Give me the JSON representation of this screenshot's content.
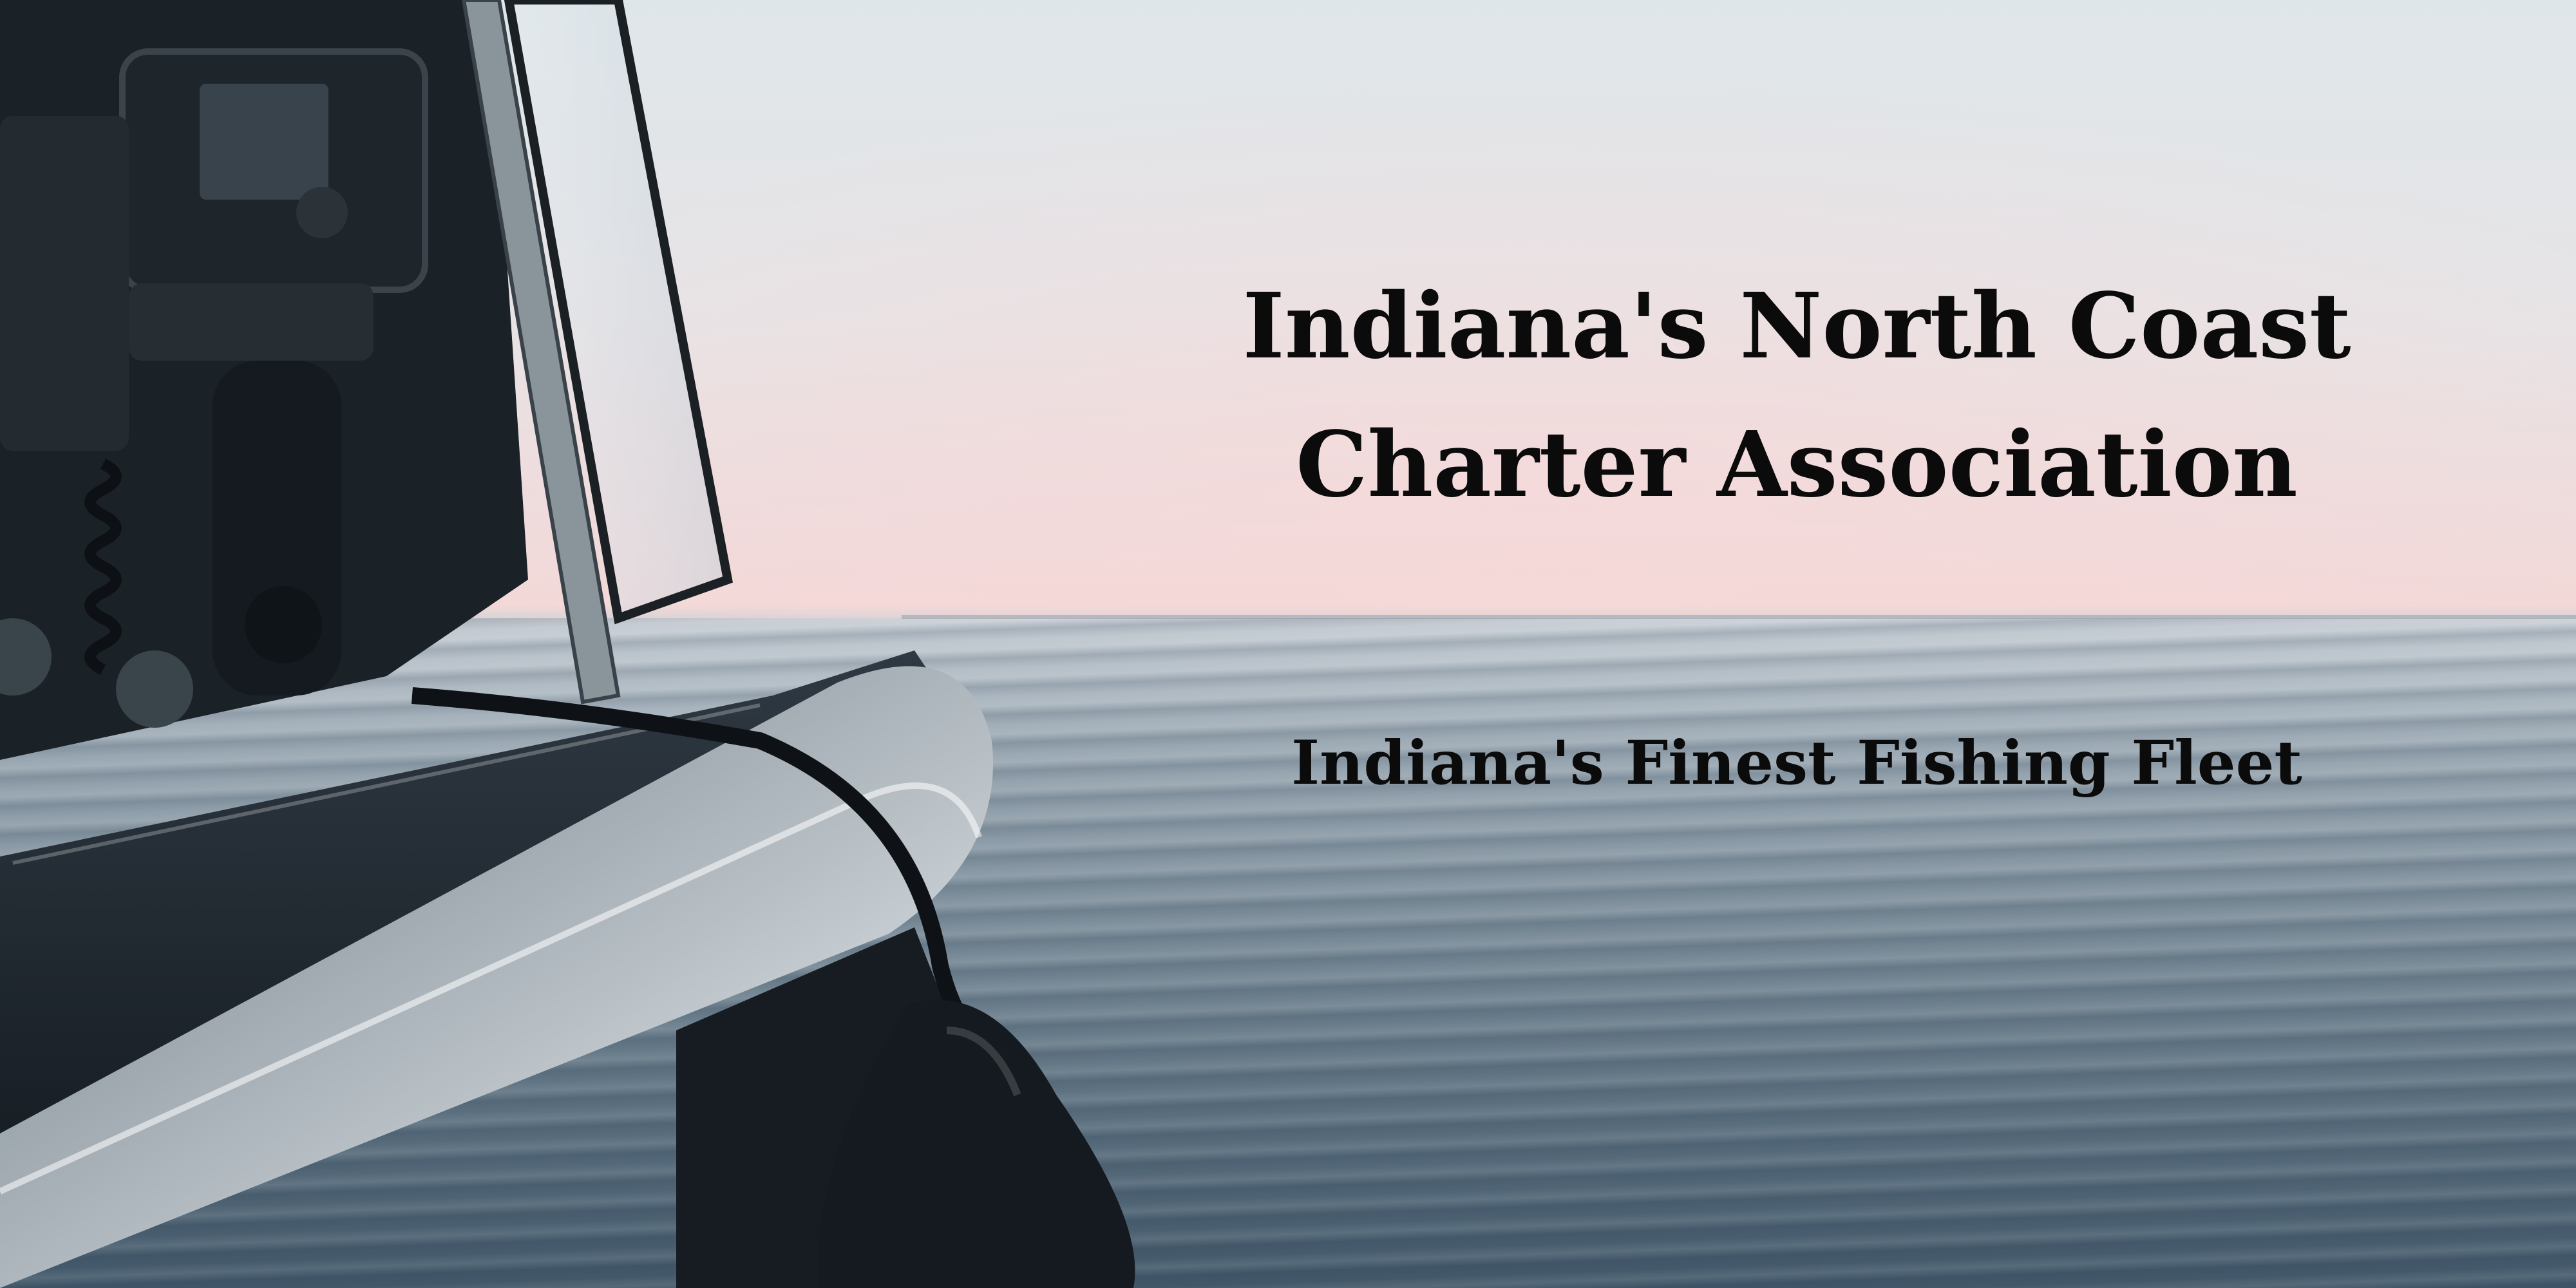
{
  "headline": {
    "line1": "Indiana's North Coast",
    "line2": "Charter Association"
  },
  "tagline": "Indiana's Finest Fishing Fleet",
  "colors": {
    "text": "#0b0b0b",
    "sky_top": "#dfe6ea",
    "sky_horizon": "#f2d9d8",
    "water": "#5f7584"
  }
}
